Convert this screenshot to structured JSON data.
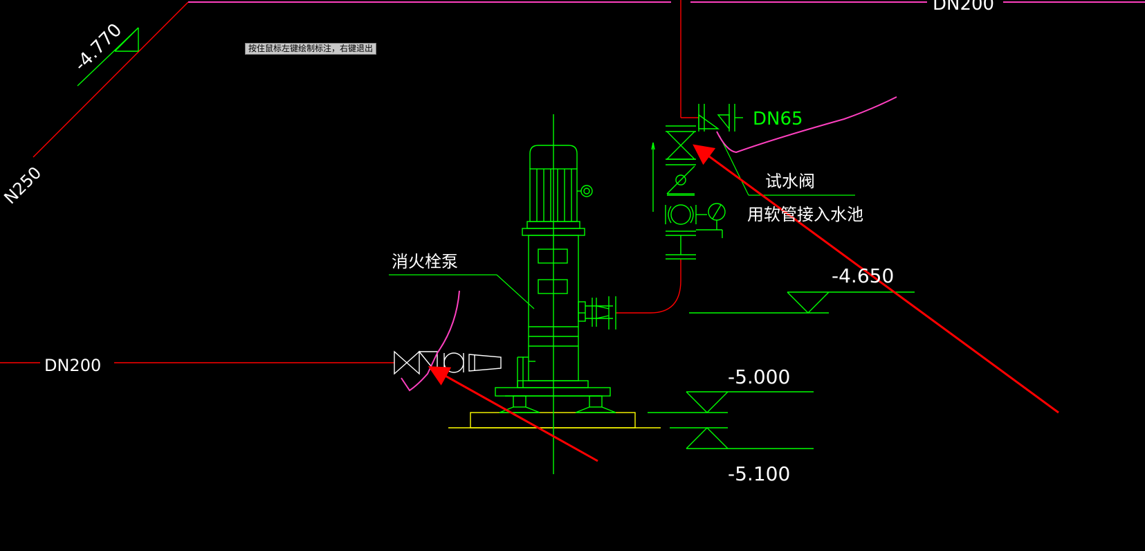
{
  "tooltip": {
    "text": "按住鼠标左键绘制标注，右键退出"
  },
  "labels": {
    "pipe_top": "DN200",
    "pipe_left": "DN200",
    "pipe_diag": "N250",
    "pipe_branch": "DN65",
    "elev_diag": "-4.770",
    "elev_a": "-4.650",
    "elev_b": "-5.000",
    "elev_c": "-5.100",
    "pump": "消火栓泵",
    "test_valve": "试水阀",
    "hose_note": "用软管接入水池"
  },
  "colors": {
    "background": "#000000",
    "equipment": "#00ff00",
    "pipe": "#ff0000",
    "annotation": "#ff40c0",
    "text": "#ffffff",
    "arrow": "#ff0000"
  }
}
